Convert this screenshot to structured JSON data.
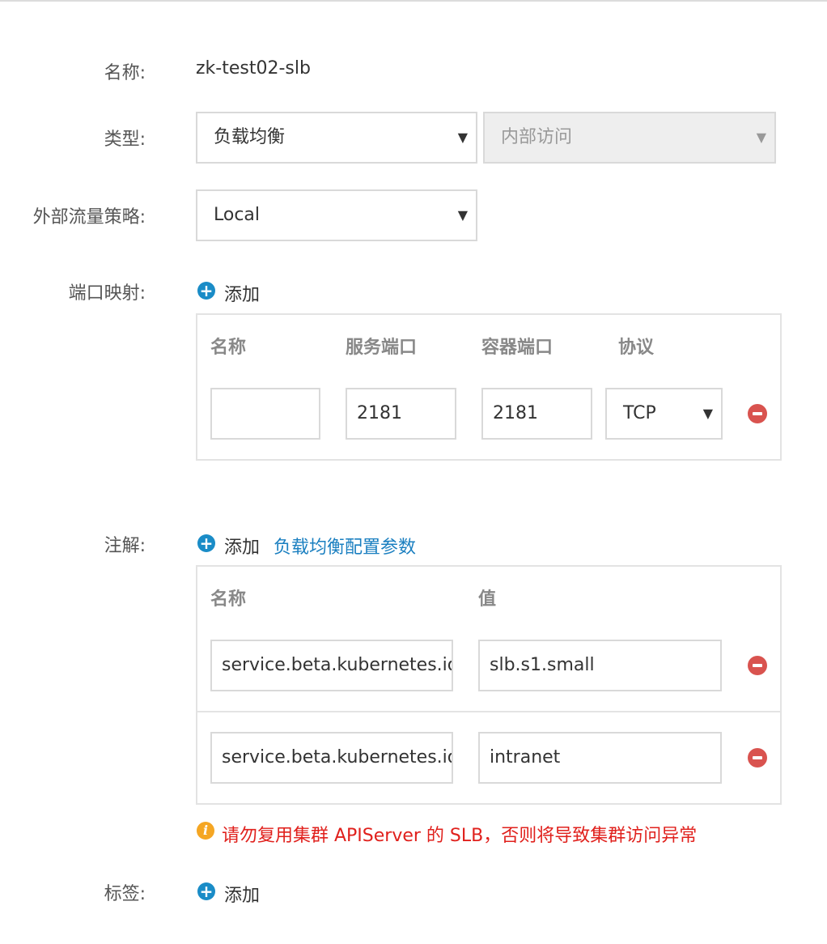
{
  "form": {
    "name": {
      "label": "名称:",
      "value": "zk-test02-slb"
    },
    "type": {
      "label": "类型:",
      "selected": "负载均衡",
      "secondary_selected": "内部访问"
    },
    "traffic_policy": {
      "label": "外部流量策略:",
      "selected": "Local"
    },
    "port_mapping": {
      "label": "端口映射:",
      "add_label": "添加",
      "headers": [
        "名称",
        "服务端口",
        "容器端口",
        "协议"
      ],
      "rows": [
        {
          "name": "",
          "service_port": "2181",
          "container_port": "2181",
          "protocol": "TCP"
        }
      ]
    },
    "annotations": {
      "label": "注解:",
      "add_label": "添加",
      "link_label": "负载均衡配置参数",
      "headers": [
        "名称",
        "值"
      ],
      "rows": [
        {
          "name": "service.beta.kubernetes.io",
          "value": "slb.s1.small"
        },
        {
          "name": "service.beta.kubernetes.io",
          "value": "intranet"
        }
      ],
      "warning": "请勿复用集群 APIServer 的 SLB，否则将导致集群访问异常"
    },
    "tags": {
      "label": "标签:",
      "add_label": "添加"
    }
  },
  "icons": {
    "add": "plus-circle-icon",
    "remove": "minus-circle-icon",
    "caret": "caret-down-icon",
    "warning": "info-icon"
  },
  "colors": {
    "accent": "#1a8cc7",
    "link": "#1a7fc0",
    "danger": "#d9534f",
    "warning_icon": "#f5a623",
    "warning_text": "#e0201c"
  }
}
